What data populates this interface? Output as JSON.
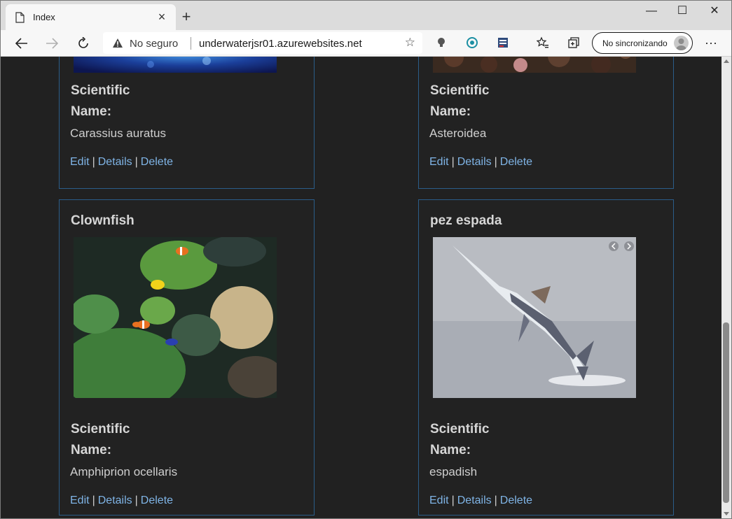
{
  "browser": {
    "tab_title": "Index",
    "new_tab": "+",
    "security_label": "No seguro",
    "url": "underwaterjsr01.azurewebsites.net",
    "sync_label": "No sincronizando",
    "more_menu": "···",
    "window_controls": {
      "minimize": "—",
      "maximize": "☐",
      "close": "✕"
    }
  },
  "cards": [
    {
      "scientific_label_1": "Scientific",
      "scientific_label_2": "Name:",
      "scientific_name": "Carassius auratus",
      "edit": "Edit",
      "details": "Details",
      "delete": "Delete"
    },
    {
      "scientific_label_1": "Scientific",
      "scientific_label_2": "Name:",
      "scientific_name": "Asteroidea",
      "edit": "Edit",
      "details": "Details",
      "delete": "Delete"
    },
    {
      "title": "Clownfish",
      "scientific_label_1": "Scientific",
      "scientific_label_2": "Name:",
      "scientific_name": "Amphiprion ocellaris",
      "edit": "Edit",
      "details": "Details",
      "delete": "Delete"
    },
    {
      "title": "pez espada",
      "scientific_label_1": "Scientific",
      "scientific_label_2": "Name:",
      "scientific_name": "espadish",
      "edit": "Edit",
      "details": "Details",
      "delete": "Delete"
    }
  ],
  "separator": "|"
}
